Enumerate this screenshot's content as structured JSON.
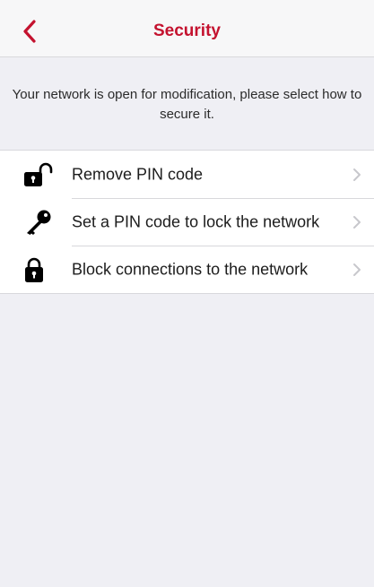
{
  "header": {
    "title": "Security",
    "back_icon": "chevron-left-icon",
    "accent_color": "#c4122f"
  },
  "description": "Your network is open for modification, please select how to secure it.",
  "options": [
    {
      "label": "Remove PIN code",
      "icon": "lock-open-icon"
    },
    {
      "label": "Set a PIN code to lock the network",
      "icon": "key-icon"
    },
    {
      "label": "Block connections to the network",
      "icon": "lock-closed-icon"
    }
  ],
  "chevron_icon": "chevron-right-icon"
}
